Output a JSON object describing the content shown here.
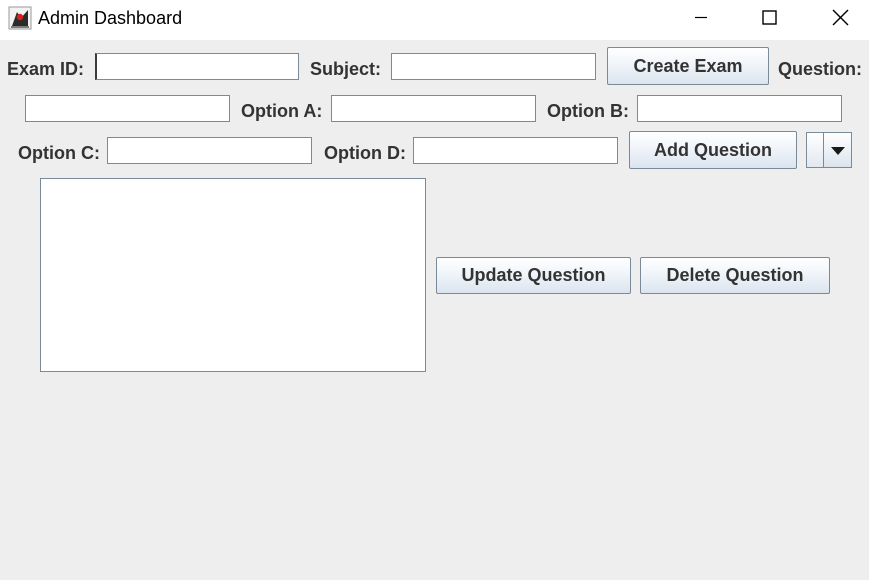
{
  "window": {
    "title": "Admin Dashboard",
    "controls": {
      "minimize_icon": "minimize-icon",
      "maximize_icon": "maximize-icon",
      "close_icon": "close-icon"
    },
    "app_icon": "java-duke-icon"
  },
  "form": {
    "exam_id_label": "Exam ID:",
    "exam_id_value": "",
    "subject_label": "Subject:",
    "subject_value": "",
    "create_exam_label": "Create Exam",
    "question_label": "Question:",
    "question_value": "",
    "option_a_label": "Option A:",
    "option_a_value": "",
    "option_b_label": "Option B:",
    "option_b_value": "",
    "option_c_label": "Option C:",
    "option_c_value": "",
    "option_d_label": "Option D:",
    "option_d_value": "",
    "add_question_label": "Add Question",
    "exam_selector_value": ""
  },
  "questions": {
    "items": [],
    "update_label": "Update Question",
    "delete_label": "Delete Question"
  },
  "colors": {
    "background": "#eeeeee",
    "titlebar": "#ffffff",
    "label_text": "#333333",
    "border": "#7a8a99"
  }
}
